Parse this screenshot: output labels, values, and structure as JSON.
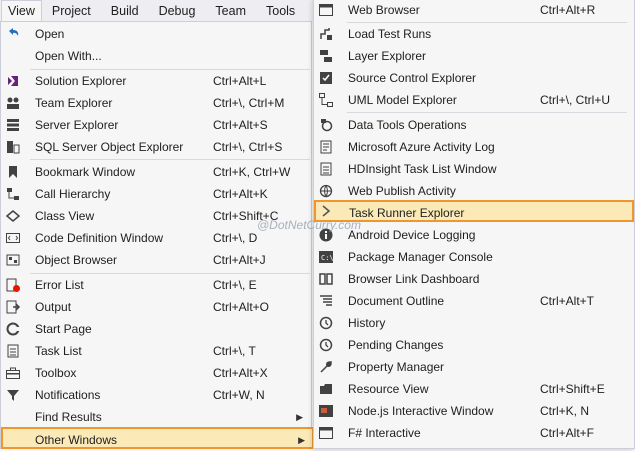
{
  "menubar": [
    "View",
    "Project",
    "Build",
    "Debug",
    "Team",
    "Tools"
  ],
  "view_menu": {
    "items": [
      {
        "label": "Open",
        "shortcut": "",
        "icon": "undo-arrow-icon"
      },
      {
        "label": "Open With...",
        "shortcut": "",
        "icon": ""
      },
      {
        "label": "Solution Explorer",
        "shortcut": "Ctrl+Alt+L",
        "icon": "solution-explorer-icon"
      },
      {
        "label": "Team Explorer",
        "shortcut": "Ctrl+\\, Ctrl+M",
        "icon": "team-explorer-icon"
      },
      {
        "label": "Server Explorer",
        "shortcut": "Ctrl+Alt+S",
        "icon": "server-explorer-icon"
      },
      {
        "label": "SQL Server Object Explorer",
        "shortcut": "Ctrl+\\, Ctrl+S",
        "icon": "sql-server-icon"
      },
      {
        "label": "Bookmark Window",
        "shortcut": "Ctrl+K, Ctrl+W",
        "icon": "bookmark-icon"
      },
      {
        "label": "Call Hierarchy",
        "shortcut": "Ctrl+Alt+K",
        "icon": "call-hierarchy-icon"
      },
      {
        "label": "Class View",
        "shortcut": "Ctrl+Shift+C",
        "icon": "class-view-icon"
      },
      {
        "label": "Code Definition Window",
        "shortcut": "Ctrl+\\, D",
        "icon": "code-definition-icon"
      },
      {
        "label": "Object Browser",
        "shortcut": "Ctrl+Alt+J",
        "icon": "object-browser-icon"
      },
      {
        "label": "Error List",
        "shortcut": "Ctrl+\\, E",
        "icon": "error-list-icon"
      },
      {
        "label": "Output",
        "shortcut": "Ctrl+Alt+O",
        "icon": "output-icon"
      },
      {
        "label": "Start Page",
        "shortcut": "",
        "icon": "start-page-icon"
      },
      {
        "label": "Task List",
        "shortcut": "Ctrl+\\, T",
        "icon": "task-list-icon"
      },
      {
        "label": "Toolbox",
        "shortcut": "Ctrl+Alt+X",
        "icon": "toolbox-icon"
      },
      {
        "label": "Notifications",
        "shortcut": "Ctrl+W, N",
        "icon": "notifications-icon"
      },
      {
        "label": "Find Results",
        "shortcut": "",
        "icon": ""
      },
      {
        "label": "Other Windows",
        "shortcut": "",
        "icon": ""
      }
    ]
  },
  "submenu": {
    "items": [
      {
        "label": "Web Browser",
        "shortcut": "Ctrl+Alt+R",
        "icon": "web-browser-icon"
      },
      {
        "label": "Load Test Runs",
        "shortcut": "",
        "icon": "load-test-icon"
      },
      {
        "label": "Layer Explorer",
        "shortcut": "",
        "icon": "layer-explorer-icon"
      },
      {
        "label": "Source Control Explorer",
        "shortcut": "",
        "icon": "source-control-icon"
      },
      {
        "label": "UML Model Explorer",
        "shortcut": "Ctrl+\\, Ctrl+U",
        "icon": "uml-model-icon"
      },
      {
        "label": "Data Tools Operations",
        "shortcut": "",
        "icon": "data-tools-icon"
      },
      {
        "label": "Microsoft Azure Activity Log",
        "shortcut": "",
        "icon": "azure-activity-icon"
      },
      {
        "label": "HDInsight Task List Window",
        "shortcut": "",
        "icon": "hdinsight-icon"
      },
      {
        "label": "Web Publish Activity",
        "shortcut": "",
        "icon": "web-publish-icon"
      },
      {
        "label": "Task Runner Explorer",
        "shortcut": "",
        "icon": "task-runner-icon"
      },
      {
        "label": "Android Device Logging",
        "shortcut": "",
        "icon": "android-logging-icon"
      },
      {
        "label": "Package Manager Console",
        "shortcut": "",
        "icon": "package-manager-icon"
      },
      {
        "label": "Browser Link Dashboard",
        "shortcut": "",
        "icon": "browser-link-icon"
      },
      {
        "label": "Document Outline",
        "shortcut": "Ctrl+Alt+T",
        "icon": "document-outline-icon"
      },
      {
        "label": "History",
        "shortcut": "",
        "icon": "history-icon"
      },
      {
        "label": "Pending Changes",
        "shortcut": "",
        "icon": "pending-changes-icon"
      },
      {
        "label": "Property Manager",
        "shortcut": "",
        "icon": "property-manager-icon"
      },
      {
        "label": "Resource View",
        "shortcut": "Ctrl+Shift+E",
        "icon": "resource-view-icon"
      },
      {
        "label": "Node.js Interactive Window",
        "shortcut": "Ctrl+K, N",
        "icon": "nodejs-icon"
      },
      {
        "label": "F# Interactive",
        "shortcut": "Ctrl+Alt+F",
        "icon": "fsharp-icon"
      }
    ]
  },
  "watermark": "@DotNetCurry.com",
  "colors": {
    "highlight_bg": "#fbe9b7",
    "highlight_border": "#f0962e",
    "menu_bg": "#f6f6f6"
  }
}
